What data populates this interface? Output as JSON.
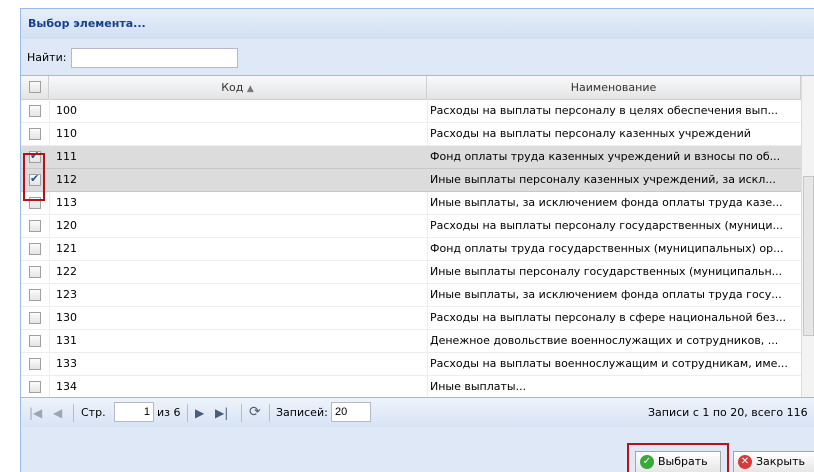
{
  "window": {
    "title": "Выбор элемента..."
  },
  "search": {
    "label": "Найти:",
    "value": ""
  },
  "grid": {
    "columns": {
      "code": "Код",
      "name": "Наименование"
    },
    "sort_indicator": "▲",
    "rows": [
      {
        "code": "100",
        "name": "Расходы на выплаты персоналу в целях обеспечения вып...",
        "checked": false
      },
      {
        "code": "110",
        "name": "Расходы на выплаты персоналу казенных учреждений",
        "checked": false
      },
      {
        "code": "111",
        "name": "Фонд оплаты труда казенных учреждений и взносы по об...",
        "checked": true
      },
      {
        "code": "112",
        "name": "Иные выплаты персоналу казенных учреждений, за искл...",
        "checked": true
      },
      {
        "code": "113",
        "name": "Иные выплаты, за исключением фонда оплаты труда казе...",
        "checked": false
      },
      {
        "code": "120",
        "name": "Расходы на выплаты персоналу государственных (муници...",
        "checked": false
      },
      {
        "code": "121",
        "name": "Фонд оплаты труда государственных (муниципальных) ор...",
        "checked": false
      },
      {
        "code": "122",
        "name": "Иные выплаты персоналу государственных (муниципальн...",
        "checked": false
      },
      {
        "code": "123",
        "name": "Иные выплаты, за исключением фонда оплаты труда госу...",
        "checked": false
      },
      {
        "code": "130",
        "name": "Расходы на выплаты персоналу в сфере национальной без...",
        "checked": false
      },
      {
        "code": "131",
        "name": "Денежное довольствие военнослужащих и сотрудников, ...",
        "checked": false
      },
      {
        "code": "133",
        "name": "Расходы на выплаты военнослужащим и сотрудникам, име...",
        "checked": false
      },
      {
        "code": "134",
        "name": "Иные выплаты...",
        "checked": false
      }
    ]
  },
  "paging": {
    "page_label": "Стр.",
    "page_value": "1",
    "of_label": "из 6",
    "records_label": "Записей:",
    "records_value": "20",
    "info": "Записи с 1 по 20, всего 116"
  },
  "footer": {
    "select_label": "Выбрать",
    "close_label": "Закрыть"
  },
  "colors": {
    "highlight": "#b3141c",
    "panel": "#dfe8f6",
    "selected_row": "#dcdcdc"
  },
  "icons": [
    "checkbox-icon",
    "sort-asc-icon",
    "first-page-icon",
    "prev-page-icon",
    "next-page-icon",
    "last-page-icon",
    "refresh-icon",
    "check-circle-icon",
    "close-circle-icon"
  ]
}
